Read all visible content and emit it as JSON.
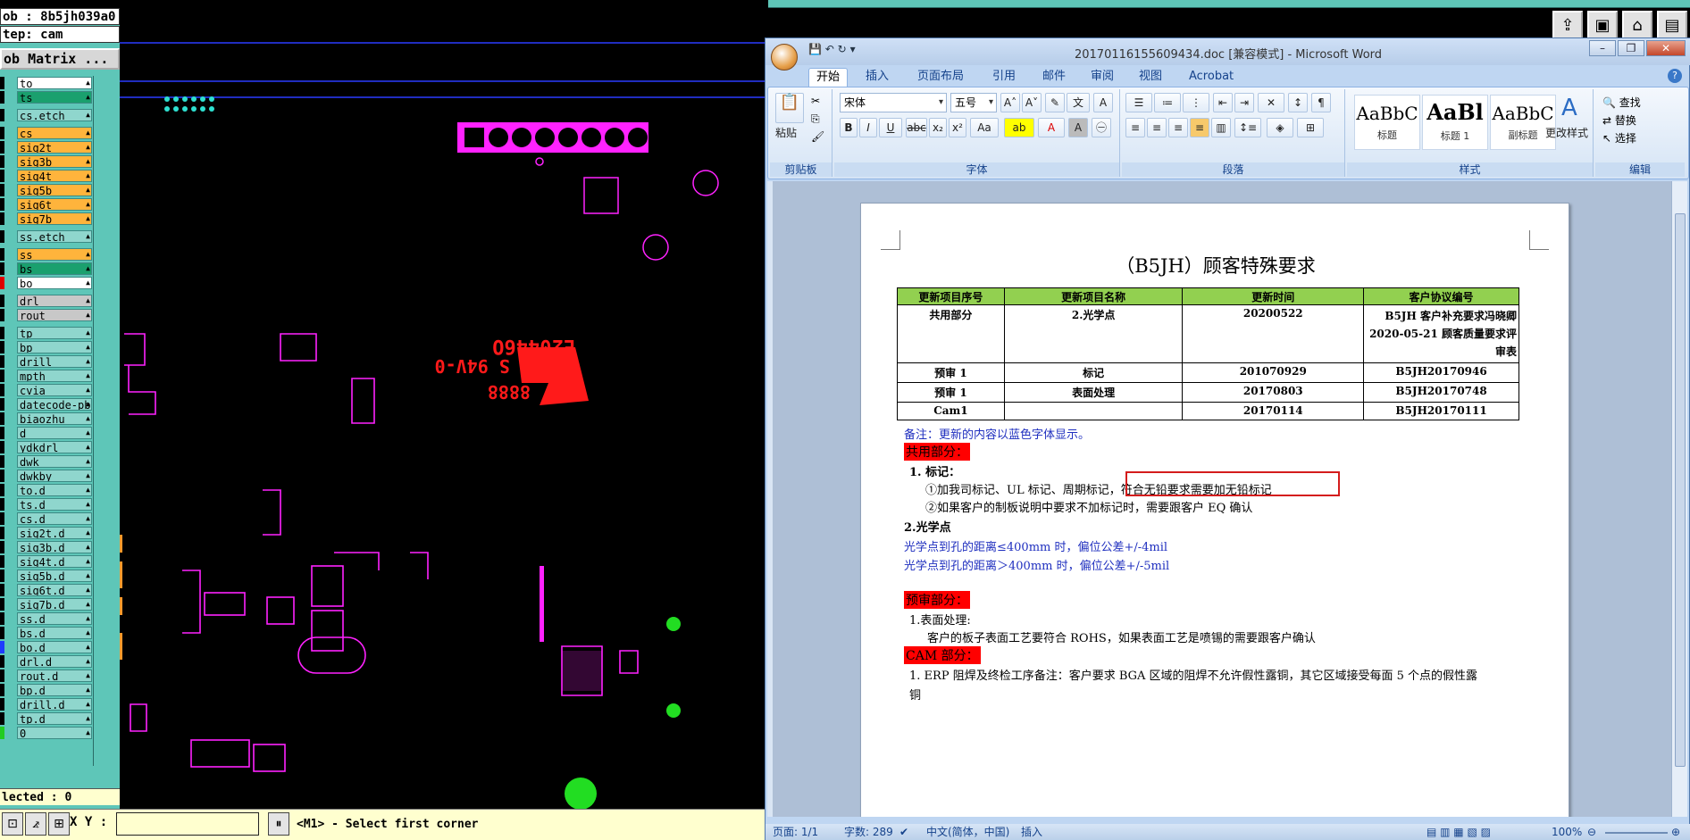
{
  "cam": {
    "job": "ob : 8b5jh039a0",
    "step": "tep: cam",
    "matrix_button": "ob Matrix ...",
    "selected": "lected : 0",
    "xy_label": "X Y :",
    "xy_value": "",
    "status": "<M1> - Select first corner",
    "layers": [
      {
        "name": "to",
        "color": "#ffffff",
        "swatch": "#000000"
      },
      {
        "name": "ts",
        "color": "#1aa06e",
        "swatch": "#000000"
      },
      {
        "name": "cs.etch",
        "color": "#8fd6cd",
        "swatch": "#000000",
        "gap": true
      },
      {
        "name": "cs",
        "color": "#ffb43c",
        "swatch": "#000000",
        "gap": true
      },
      {
        "name": "sig2t",
        "color": "#ffb43c",
        "swatch": "#000000"
      },
      {
        "name": "sig3b",
        "color": "#ffb43c",
        "swatch": "#000000"
      },
      {
        "name": "sig4t",
        "color": "#ffb43c",
        "swatch": "#000000"
      },
      {
        "name": "sig5b",
        "color": "#ffb43c",
        "swatch": "#000000"
      },
      {
        "name": "sig6t",
        "color": "#ffb43c",
        "swatch": "#000000"
      },
      {
        "name": "sig7b",
        "color": "#ffb43c",
        "swatch": "#000000"
      },
      {
        "name": "ss.etch",
        "color": "#8fd6cd",
        "swatch": "#000000",
        "gap": true
      },
      {
        "name": "ss",
        "color": "#ffb43c",
        "swatch": "#000000",
        "gap": true
      },
      {
        "name": "bs",
        "color": "#1aa06e",
        "swatch": "#000000"
      },
      {
        "name": "bo",
        "color": "#ffffff",
        "swatch": "#e00000"
      },
      {
        "name": "drl",
        "color": "#c8c8c8",
        "swatch": "#000000",
        "gap": true
      },
      {
        "name": "rout",
        "color": "#c8c8c8",
        "swatch": "#000000"
      },
      {
        "name": "tp",
        "color": "#8fd6cd",
        "swatch": "#000000",
        "gap": true
      },
      {
        "name": "bp",
        "color": "#8fd6cd",
        "swatch": "#000000"
      },
      {
        "name": "drill",
        "color": "#8fd6cd",
        "swatch": "#000000"
      },
      {
        "name": "mpth",
        "color": "#8fd6cd",
        "swatch": "#000000"
      },
      {
        "name": "cvia",
        "color": "#8fd6cd",
        "swatch": "#000000"
      },
      {
        "name": "datecode-pbe",
        "color": "#8fd6cd",
        "swatch": "#000000"
      },
      {
        "name": "biaozhu",
        "color": "#8fd6cd",
        "swatch": "#000000"
      },
      {
        "name": "d",
        "color": "#8fd6cd",
        "swatch": "#000000"
      },
      {
        "name": "ydkdrl",
        "color": "#8fd6cd",
        "swatch": "#000000"
      },
      {
        "name": "dwk",
        "color": "#8fd6cd",
        "swatch": "#000000"
      },
      {
        "name": "dwkby",
        "color": "#8fd6cd",
        "swatch": "#000000"
      },
      {
        "name": "to.d",
        "color": "#8fd6cd",
        "swatch": "#000000"
      },
      {
        "name": "ts.d",
        "color": "#8fd6cd",
        "swatch": "#000000"
      },
      {
        "name": "cs.d",
        "color": "#8fd6cd",
        "swatch": "#000000"
      },
      {
        "name": "sig2t.d",
        "color": "#8fd6cd",
        "swatch": "#000000"
      },
      {
        "name": "sig3b.d",
        "color": "#8fd6cd",
        "swatch": "#000000"
      },
      {
        "name": "sig4t.d",
        "color": "#8fd6cd",
        "swatch": "#000000"
      },
      {
        "name": "sig5b.d",
        "color": "#8fd6cd",
        "swatch": "#000000"
      },
      {
        "name": "sig6t.d",
        "color": "#8fd6cd",
        "swatch": "#000000"
      },
      {
        "name": "sig7b.d",
        "color": "#8fd6cd",
        "swatch": "#000000"
      },
      {
        "name": "ss.d",
        "color": "#8fd6cd",
        "swatch": "#000000"
      },
      {
        "name": "bs.d",
        "color": "#8fd6cd",
        "swatch": "#000000"
      },
      {
        "name": "bo.d",
        "color": "#8fd6cd",
        "swatch": "#1e3cff"
      },
      {
        "name": "drl.d",
        "color": "#8fd6cd",
        "swatch": "#000000"
      },
      {
        "name": "rout.d",
        "color": "#8fd6cd",
        "swatch": "#000000"
      },
      {
        "name": "bp.d",
        "color": "#8fd6cd",
        "swatch": "#000000"
      },
      {
        "name": "drill.d",
        "color": "#8fd6cd",
        "swatch": "#000000"
      },
      {
        "name": "tp.d",
        "color": "#8fd6cd",
        "swatch": "#000000"
      },
      {
        "name": "0",
        "color": "#8fd6cd",
        "swatch": "#22cc22"
      }
    ],
    "pcb_labels": {
      "logo_code": "E20446O",
      "logo_line2": "M11 S 94V-0",
      "logo_line3": "8888"
    }
  },
  "word": {
    "title": "20170116155609434.doc [兼容模式] - Microsoft Word",
    "tabs": [
      "开始",
      "插入",
      "页面布局",
      "引用",
      "邮件",
      "审阅",
      "视图",
      "Acrobat"
    ],
    "ribbon": {
      "paste": "粘贴",
      "clipboard": "剪贴板",
      "font_name": "宋体",
      "font_size": "五号",
      "font_group": "字体",
      "paragraph_group": "段落",
      "styles_group": "样式",
      "edit_group": "编辑",
      "style_samples": [
        {
          "sample": "AaBbC",
          "name": "标题"
        },
        {
          "sample": "AaBl",
          "name": "标题 1"
        },
        {
          "sample": "AaBbC",
          "name": "副标题"
        }
      ],
      "change_styles": "更改样式",
      "find": "查找",
      "replace": "替换",
      "select": "选择"
    },
    "doc": {
      "title": "（B5JH）顾客特殊要求",
      "table_headers": [
        "更新项目序号",
        "更新项目名称",
        "更新时间",
        "客户协议编号"
      ],
      "table_rows": [
        [
          "共用部分",
          "2.光学点",
          "20200522",
          "B5JH 客户补充要求冯晓卿 2020-05-21 顾客质量要求评审表"
        ],
        [
          "预审 1",
          "标记",
          "201070929",
          "B5JH20170946"
        ],
        [
          "预审 1",
          "表面处理",
          "20170803",
          "B5JH20170748"
        ],
        [
          "Cam1",
          "",
          "20170114",
          "B5JH20170111"
        ]
      ],
      "note": "备注：更新的内容以蓝色字体显示。",
      "section_common": "共用部分：",
      "mark_heading": "1. 标记：",
      "mark_line1": "①加我司标记、UL 标记、周期标记，符合无铅要求需要加无铅标记",
      "mark_line2": "②如果客户的制板说明中要求不加标记时，需要跟客户 EQ 确认",
      "optical_heading": "2.光学点",
      "optical_line1": "光学点到孔的距离≤400mm 时，偏位公差+/-4mil",
      "optical_line2": "光学点到孔的距离＞400mm 时，偏位公差+/-5mil",
      "section_pre": "预审部分：",
      "surface_heading": "1.表面处理:",
      "surface_line": "客户的板子表面工艺要符合 ROHS，如果表面工艺是喷锡的需要跟客户确认",
      "section_cam": "CAM 部分：",
      "erp_line1": "1. ERP 阻焊及终检工序备注：客户要求 BGA 区域的阻焊不允许假性露铜，其它区域接受每面 5 个点的假性露",
      "erp_line2": "铜"
    },
    "status": {
      "page": "页面: 1/1",
      "words": "字数: 289",
      "language": "中文(简体，中国)",
      "insert": "插入",
      "zoom": "100%"
    }
  }
}
